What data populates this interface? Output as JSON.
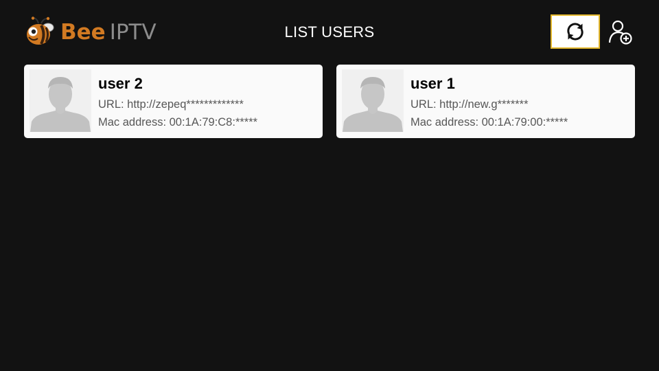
{
  "header": {
    "logo": {
      "brand": "Bee",
      "product": "IPTV",
      "icon": "bee-icon",
      "brand_color": "#d27a22"
    },
    "title": "LIST USERS",
    "refresh_icon": "refresh-icon",
    "add_user_icon": "add-user-icon",
    "focus_color": "#e3b72c"
  },
  "users": [
    {
      "name": "user 2",
      "url": "URL: http://zepeq*************",
      "mac": "Mac address: 00:1A:79:C8:*****",
      "avatar": "avatar-placeholder"
    },
    {
      "name": "user 1",
      "url": "URL: http://new.g*******",
      "mac": "Mac address: 00:1A:79:00:*****",
      "avatar": "avatar-placeholder"
    }
  ]
}
